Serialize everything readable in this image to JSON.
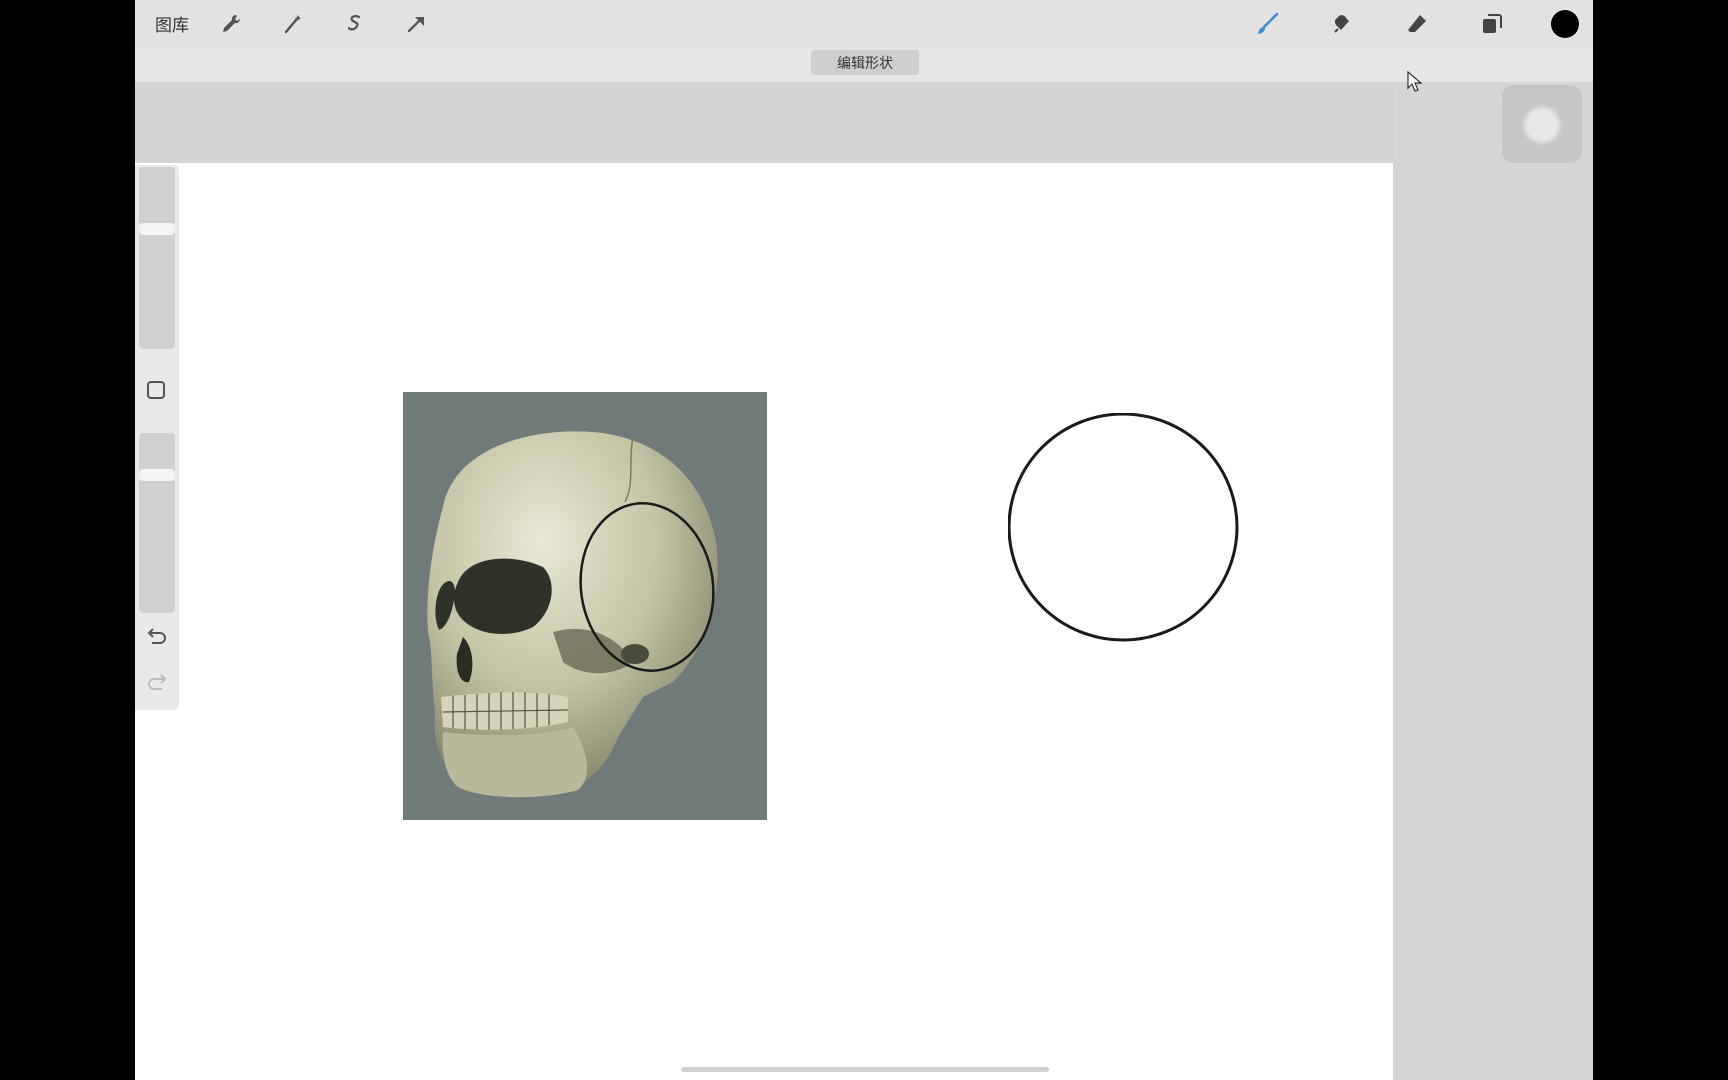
{
  "topbar": {
    "gallery_label": "图库",
    "left_tools": [
      "wrench-icon",
      "magic-wand-icon",
      "selection-icon",
      "move-arrow-icon"
    ],
    "right_tools": [
      "brush-icon",
      "smudge-icon",
      "eraser-icon",
      "layers-icon",
      "color-swatch"
    ],
    "active_tool": "brush-icon",
    "accent_color": "#3b8ad6",
    "current_color": "#000000"
  },
  "subbar": {
    "edit_shape_label": "编辑形状"
  },
  "sidebar": {
    "tools": [
      "brush-size-slider",
      "modify-square-button",
      "opacity-slider",
      "undo-icon",
      "redo-icon"
    ]
  },
  "canvas": {
    "background": "#ffffff",
    "reference_image": "skull-reference",
    "shapes": [
      "ellipse-on-skull",
      "circle"
    ]
  }
}
